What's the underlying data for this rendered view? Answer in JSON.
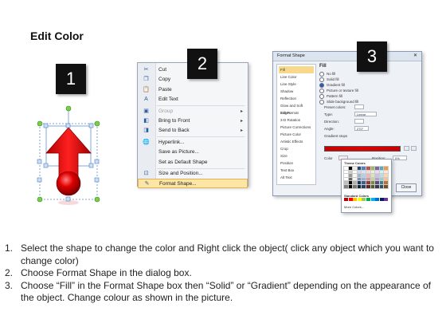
{
  "title": "Edit Color",
  "steps": {
    "badges": [
      "1",
      "2",
      "3"
    ]
  },
  "context_menu": {
    "items": [
      {
        "label": "Cut",
        "icon": "scissors-icon",
        "glyph": "✂",
        "enabled": true,
        "submenu": false
      },
      {
        "label": "Copy",
        "icon": "copy-icon",
        "glyph": "❐",
        "enabled": true,
        "submenu": false
      },
      {
        "label": "Paste",
        "icon": "paste-icon",
        "glyph": "📋",
        "enabled": true,
        "submenu": false
      },
      {
        "label": "Edit Text",
        "icon": "edit-text-icon",
        "glyph": "A",
        "enabled": true,
        "submenu": false
      },
      {
        "label": "Group",
        "icon": "group-icon",
        "glyph": "▣",
        "enabled": false,
        "submenu": true
      },
      {
        "label": "Bring to Front",
        "icon": "bring-front-icon",
        "glyph": "◧",
        "enabled": true,
        "submenu": true
      },
      {
        "label": "Send to Back",
        "icon": "send-back-icon",
        "glyph": "◨",
        "enabled": true,
        "submenu": true
      },
      {
        "label": "Hyperlink...",
        "icon": "hyperlink-icon",
        "glyph": "🌐",
        "enabled": true,
        "submenu": false
      },
      {
        "label": "Save as Picture...",
        "icon": "",
        "glyph": "",
        "enabled": true,
        "submenu": false
      },
      {
        "label": "Set as Default Shape",
        "icon": "",
        "glyph": "",
        "enabled": true,
        "submenu": false
      },
      {
        "label": "Size and Position...",
        "icon": "size-icon",
        "glyph": "⊡",
        "enabled": true,
        "submenu": false
      },
      {
        "label": "Format Shape...",
        "icon": "format-shape-icon",
        "glyph": "✎",
        "enabled": true,
        "submenu": false,
        "highlighted": true
      }
    ]
  },
  "format_dialog": {
    "title": "Format Shape",
    "close_glyph": "✕",
    "categories": [
      "Fill",
      "Line Color",
      "Line Style",
      "Shadow",
      "Reflection",
      "Glow and Soft Edges",
      "3-D Format",
      "3-D Rotation",
      "Picture Corrections",
      "Picture Color",
      "Artistic Effects",
      "Crop",
      "Size",
      "Position",
      "Text Box",
      "Alt Text"
    ],
    "panel_title": "Fill",
    "fill_options": [
      "No fill",
      "Solid fill",
      "Gradient fill",
      "Picture or texture fill",
      "Pattern fill",
      "Slide background fill"
    ],
    "preset_label": "Preset colors:",
    "type_label": "Type:",
    "type_value": "Linear",
    "direction_label": "Direction:",
    "angle_label": "Angle:",
    "angle_value": "270°",
    "gradient_stops_label": "Gradient stops",
    "color_label": "Color",
    "position_label": "Position:",
    "position_value": "0%",
    "brightness_label": "Brightness:",
    "transparency_label": "Transparency:",
    "rotate_label": "Rotate with shape",
    "close_button": "Close"
  },
  "palette": {
    "theme_header": "Theme Colors",
    "standard_header": "Standard Colors",
    "more_colors": "More Colors...",
    "theme_row": [
      "#ffffff",
      "#000000",
      "#eeece1",
      "#1f497d",
      "#4f81bd",
      "#c0504d",
      "#9bbb59",
      "#8064a2",
      "#4bacc6",
      "#f79646"
    ],
    "standard": [
      "#c00000",
      "#ff0000",
      "#ffc000",
      "#ffff00",
      "#92d050",
      "#00b050",
      "#00b0f0",
      "#0070c0",
      "#002060",
      "#7030a0"
    ]
  },
  "instructions": [
    {
      "num": "1.",
      "text": "Select the shape to change the color and Right click the object( click any object which you want to change color)"
    },
    {
      "num": "2.",
      "text": "Choose Format Shape in the dialog box."
    },
    {
      "num": "3.",
      "text": "Choose “Fill” in the Format Shape box then “Solid” or “Gradient” depending on the appearance of the object. Change colour as shown in the picture."
    }
  ],
  "colors": {
    "arrow_red": "#e00000",
    "handle_green": "#7ccd4c",
    "handle_blue": "#7fa9d9"
  }
}
